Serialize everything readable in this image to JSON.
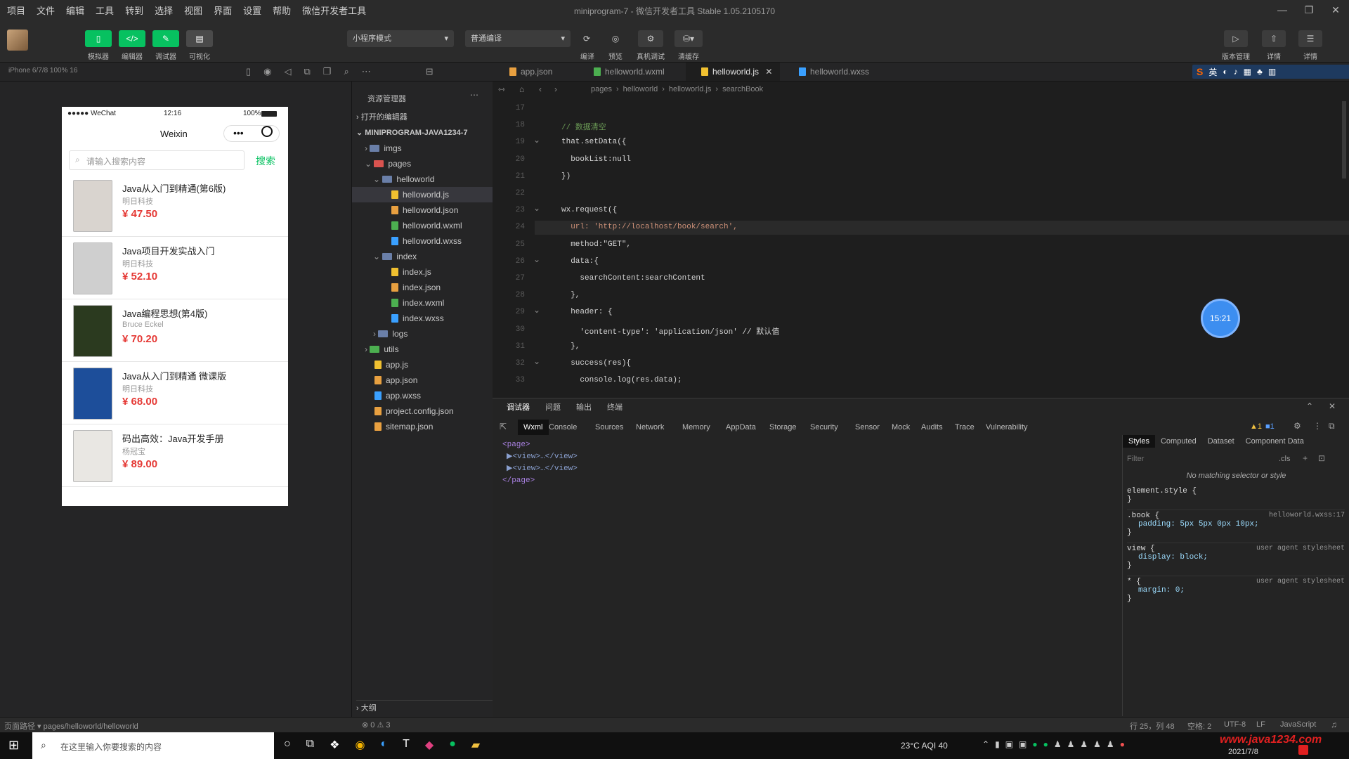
{
  "menubar": {
    "items": [
      "项目",
      "文件",
      "编辑",
      "工具",
      "转到",
      "选择",
      "视图",
      "界面",
      "设置",
      "帮助",
      "微信开发者工具"
    ],
    "title": "miniprogram-7 - 微信开发者工具 Stable 1.05.2105170"
  },
  "toolbar": {
    "simulator_label": "模拟器",
    "editor_label": "编辑器",
    "debugger_label": "调试器",
    "visual_label": "可视化",
    "mode_select": "小程序模式",
    "compile_select": "普通编译",
    "compile_label": "编译",
    "preview_label": "预览",
    "realdebug_label": "真机调试",
    "clearcache_label": "清缓存",
    "upload_label": "版本管理",
    "version_label": "详情",
    "details_label": "详情"
  },
  "simulator": {
    "device": "iPhone 6/7/8 100% 16",
    "status_carrier": "●●●●● WeChat",
    "status_time": "12:16",
    "status_battery": "100%",
    "nav_title": "Weixin",
    "search_placeholder": "请输入搜索内容",
    "search_button": "搜索",
    "books": [
      {
        "title": "Java从入门到精通(第6版)",
        "author": "明日科技",
        "price": "¥ 47.50",
        "cover": "#d9d4cf"
      },
      {
        "title": "Java项目开发实战入门",
        "author": "明日科技",
        "price": "¥ 52.10",
        "cover": "#cfcfcf"
      },
      {
        "title": "Java编程思想(第4版)",
        "author": "Bruce Eckel",
        "price": "¥ 70.20",
        "cover": "#2b3a1f"
      },
      {
        "title": "Java从入门到精通 微课版",
        "author": "明日科技",
        "price": "¥ 68.00",
        "cover": "#1d4e9a"
      },
      {
        "title": "码出高效：Java开发手册",
        "author": "杨冠宝",
        "price": "¥ 89.00",
        "cover": "#e9e7e3"
      }
    ]
  },
  "explorer": {
    "title": "资源管理器",
    "open_editors": "打开的编辑器",
    "project": "MINIPROGRAM-JAVA1234-7",
    "tree": [
      {
        "name": "imgs",
        "depth": 1,
        "type": "folder"
      },
      {
        "name": "pages",
        "depth": 1,
        "type": "folder-open"
      },
      {
        "name": "helloworld",
        "depth": 2,
        "type": "folder-open"
      },
      {
        "name": "helloworld.js",
        "depth": 3,
        "type": "js",
        "selected": true
      },
      {
        "name": "helloworld.json",
        "depth": 3,
        "type": "json"
      },
      {
        "name": "helloworld.wxml",
        "depth": 3,
        "type": "wxml"
      },
      {
        "name": "helloworld.wxss",
        "depth": 3,
        "type": "wxss"
      },
      {
        "name": "index",
        "depth": 2,
        "type": "folder-open"
      },
      {
        "name": "index.js",
        "depth": 3,
        "type": "js"
      },
      {
        "name": "index.json",
        "depth": 3,
        "type": "json"
      },
      {
        "name": "index.wxml",
        "depth": 3,
        "type": "wxml"
      },
      {
        "name": "index.wxss",
        "depth": 3,
        "type": "wxss"
      },
      {
        "name": "logs",
        "depth": 2,
        "type": "folder"
      },
      {
        "name": "utils",
        "depth": 1,
        "type": "folder"
      },
      {
        "name": "app.js",
        "depth": 1,
        "type": "js"
      },
      {
        "name": "app.json",
        "depth": 1,
        "type": "json"
      },
      {
        "name": "app.wxss",
        "depth": 1,
        "type": "wxss"
      },
      {
        "name": "project.config.json",
        "depth": 1,
        "type": "json"
      },
      {
        "name": "sitemap.json",
        "depth": 1,
        "type": "json"
      }
    ],
    "outline": "大纲"
  },
  "tabs": [
    {
      "name": "app.json",
      "type": "json"
    },
    {
      "name": "helloworld.wxml",
      "type": "wxml"
    },
    {
      "name": "helloworld.js",
      "type": "js",
      "active": true
    },
    {
      "name": "helloworld.wxss",
      "type": "wxss"
    }
  ],
  "breadcrumb": [
    "pages",
    "helloworld",
    "helloworld.js",
    "searchBook"
  ],
  "editor": {
    "lines": [
      {
        "n": "17",
        "text": ""
      },
      {
        "n": "18",
        "text": "// 数据清空"
      },
      {
        "n": "19",
        "text": "that.setData({"
      },
      {
        "n": "20",
        "text": "  bookList:null"
      },
      {
        "n": "21",
        "text": "})"
      },
      {
        "n": "22",
        "text": ""
      },
      {
        "n": "23",
        "text": "wx.request({"
      },
      {
        "n": "24",
        "text": "  url: 'http://localhost/book/search',"
      },
      {
        "n": "25",
        "text": "  method:\"GET\","
      },
      {
        "n": "26",
        "text": "  data:{"
      },
      {
        "n": "27",
        "text": "    searchContent:searchContent"
      },
      {
        "n": "28",
        "text": "  },"
      },
      {
        "n": "29",
        "text": "  header: {"
      },
      {
        "n": "30",
        "text": "    'content-type': 'application/json' // 默认值"
      },
      {
        "n": "31",
        "text": "  },"
      },
      {
        "n": "32",
        "text": "  success(res){"
      },
      {
        "n": "33",
        "text": "    console.log(res.data);"
      }
    ],
    "timer_badge": "15:21"
  },
  "devtools": {
    "panel_tabs": [
      "调试器",
      "问题",
      "输出",
      "终端"
    ],
    "tabs": [
      "Wxml",
      "Console",
      "Sources",
      "Network",
      "Memory",
      "AppData",
      "Storage",
      "Security",
      "Sensor",
      "Mock",
      "Audits",
      "Trace",
      "Vulnerability"
    ],
    "warnings": "▲1",
    "infos": "■1",
    "wxml_lines": [
      "<page>",
      "▶<view>…</view>",
      "▶<view>…</view>",
      "</page>"
    ],
    "style_tabs": [
      "Styles",
      "Computed",
      "Dataset",
      "Component Data"
    ],
    "filter_placeholder": "Filter",
    "cls_label": ".cls",
    "no_match": "No matching selector or style",
    "rules": [
      {
        "selector": "element.style {",
        "source": "",
        "body": "",
        "close": "}"
      },
      {
        "selector": ".book {",
        "source": "helloworld.wxss:17",
        "body": "padding: 5px 5px 0px 10px;",
        "close": "}"
      },
      {
        "selector": "view {",
        "source": "user agent stylesheet",
        "body": "display: block;",
        "close": "}"
      },
      {
        "selector": "* {",
        "source": "user agent stylesheet",
        "body": "margin: 0;",
        "close": "}"
      }
    ]
  },
  "statusbar": {
    "left_path": "页面路径 ▾   pages/helloworld/helloworld",
    "errors": "⊗ 0 ⚠ 3",
    "position": "行 25，列 48",
    "spaces": "空格: 2",
    "encoding": "UTF-8",
    "eol": "LF",
    "language": "JavaScript"
  },
  "taskbar": {
    "search_placeholder": "在这里输入你要搜索的内容",
    "weather": "23°C  AQI 40",
    "date": "2021/7/8",
    "watermark": "www.java1234.com"
  }
}
